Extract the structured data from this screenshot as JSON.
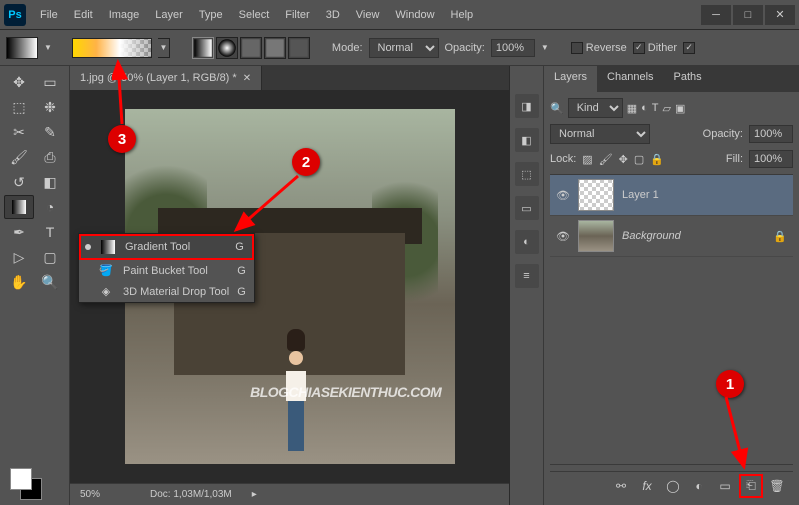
{
  "app": {
    "logo": "Ps"
  },
  "menu": [
    "File",
    "Edit",
    "Image",
    "Layer",
    "Type",
    "Select",
    "Filter",
    "3D",
    "View",
    "Window",
    "Help"
  ],
  "options": {
    "mode_label": "Mode:",
    "mode_value": "Normal",
    "opacity_label": "Opacity:",
    "opacity_value": "100%",
    "reverse_label": "Reverse",
    "dither_label": "Dither"
  },
  "document": {
    "tab_title": "1.jpg @ 50% (Layer 1, RGB/8) *",
    "zoom": "50%",
    "doc_info": "Doc: 1,03M/1,03M",
    "watermark": "BLOGCHIASEKIENTHUC.COM"
  },
  "flyout": {
    "items": [
      {
        "label": "Gradient Tool",
        "key": "G",
        "selected": true
      },
      {
        "label": "Paint Bucket Tool",
        "key": "G",
        "selected": false
      },
      {
        "label": "3D Material Drop Tool",
        "key": "G",
        "selected": false
      }
    ]
  },
  "panels": {
    "tabs": [
      "Layers",
      "Channels",
      "Paths"
    ],
    "kind_label": "Kind",
    "blend_mode": "Normal",
    "opacity_label": "Opacity:",
    "opacity_value": "100%",
    "lock_label": "Lock:",
    "fill_label": "Fill:",
    "fill_value": "100%",
    "layers": [
      {
        "name": "Layer 1",
        "active": true,
        "thumb": "trans",
        "locked": false
      },
      {
        "name": "Background",
        "active": false,
        "thumb": "photo",
        "locked": true
      }
    ]
  },
  "annotations": {
    "n1": "1",
    "n2": "2",
    "n3": "3"
  }
}
